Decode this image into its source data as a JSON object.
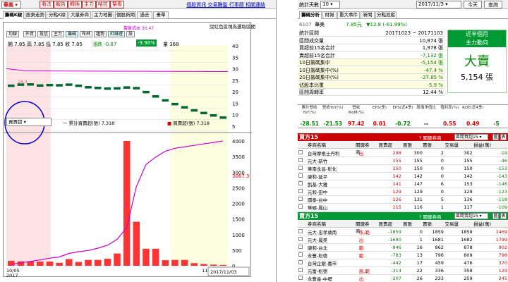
{
  "left": {
    "stock_select": "華美",
    "buttons": [
      "看法",
      "報告",
      "轉換",
      "主力",
      "哈拉",
      "幫看"
    ],
    "links": "個股資訊  交易騰盤  行事曆  相關連結",
    "tabs": [
      "籌碼K線",
      "股東走勢",
      "分點K線",
      "大量券商",
      "主力地圖",
      "個股新聞",
      "過去",
      "畫單"
    ],
    "note": "說紅色區塊為選取區間",
    "mini_buttons": [
      "均線",
      "外資",
      "投信",
      "主力",
      "籌碼",
      "布林",
      "趨勢",
      "紅綠燈",
      "設"
    ],
    "ohlc": "開 7.85  高 7.85  低 7.85  收 7.85",
    "change": "漲跌 -0.87",
    "change_pct": "-9.98%",
    "volume": "量 368",
    "cost_label": "籌量成本 30.47",
    "sub_select": "買賣超",
    "legend1": "一 累計買賣超(張) 7,318",
    "legend2": "買賣超(張) 7,318",
    "price_marker": "3067.3",
    "x_start": "10/05",
    "x_year": "2017",
    "x_mid": "11/01",
    "x_end": "2017/11/03",
    "y_top": [
      "40",
      "35",
      "30",
      "25",
      "20",
      "15",
      "10",
      "5"
    ],
    "y_bot": [
      "4000",
      "3500",
      "3000",
      "2500",
      "2000",
      "1500",
      "1000",
      "500",
      "0"
    ]
  },
  "right": {
    "days_label": "統計天數",
    "days_value": "10",
    "date": "2017/11/3",
    "btn_today": "今天",
    "btn_query": "查詢",
    "tabs": [
      "籌碼分析",
      "財報",
      "重大事件",
      "新聞",
      "分點追蹤"
    ],
    "stock_code": "6107",
    "stock_name": "華美",
    "stock_price": "7.85元",
    "stock_change": "▼12.8 (-61.99%)",
    "rows": [
      {
        "k": "統計區間",
        "v": "20171023 ~ 20171103"
      },
      {
        "k": "區間成交量",
        "v": "10,874 張"
      },
      {
        "k": "買超前15名合計",
        "v": "1,978 張"
      },
      {
        "k": "賣超前15名合計",
        "v": "-7,132 張"
      },
      {
        "k": "10日籌碼集中",
        "v": "-5,154 張"
      },
      {
        "k": "10日籌碼集中(%)",
        "v": "-47.4 %"
      },
      {
        "k": "20日籌碼集中(%)",
        "v": "-27.85 %"
      },
      {
        "k": "佔股本比重",
        "v": "-5.9 %"
      },
      {
        "k": "區間周轉率",
        "v": "12.44 %"
      }
    ],
    "box_title": "近半個月",
    "box_sub": "主力動向",
    "box_big": "大賣",
    "box_val": "5,154 張",
    "metrics_head": [
      "累計營收YoY(%)",
      "營收YoY(%)",
      "營收MoM(%)",
      "EPS(季)",
      "EPS(近4季)",
      "股價淨值比",
      "殖利率(%)",
      "ROE(近4季)"
    ],
    "metrics_val": [
      "-28.51",
      "-21.53",
      "97.42",
      "0.01",
      "-0.72",
      "--",
      "0.55",
      "0.49",
      "-5"
    ],
    "buy_title": "買方15",
    "sell_title": "賣方15",
    "filter_label": "?  關鍵券商",
    "filter_value": "區間買超15",
    "filter_value2": "區間賣超15",
    "col_heads": [
      "券商名稱",
      "關鍵券商",
      "買賣超",
      "買張",
      "賣張",
      "交易量",
      "損益(萬)"
    ],
    "buy_rows": [
      [
        "台灣摩根士丹利",
        "出",
        "298",
        "300",
        "2",
        "302",
        "-19"
      ],
      [
        "元大-新竹",
        "",
        "155",
        "155",
        "0",
        "155",
        "-46"
      ],
      [
        "華南永昌-彰化",
        "",
        "150",
        "150",
        "0",
        "150",
        "-153"
      ],
      [
        "康和-延平",
        "",
        "142",
        "142",
        "0",
        "142",
        "-143"
      ],
      [
        "凱基-大雅",
        "",
        "141",
        "147",
        "6",
        "153",
        "-146"
      ],
      [
        "元和-田中",
        "",
        "129",
        "129",
        "0",
        "129",
        "-123"
      ],
      [
        "國泰-台中",
        "",
        "126",
        "131",
        "5",
        "136",
        "-118"
      ],
      [
        "華碩-鳳山",
        "",
        "115",
        "116",
        "1",
        "117",
        "-109"
      ],
      [
        "國泰-板橋",
        "風",
        "111",
        "111",
        "0",
        "111",
        "-105"
      ]
    ],
    "sell_rows": [
      [
        "元大-忠孝敦南",
        "作,範",
        "-1859",
        "0",
        "1859",
        "1859",
        "1469"
      ],
      [
        "元大-鳳美",
        "出",
        "-1680",
        "1",
        "1681",
        "1682",
        "1799"
      ],
      [
        "康和-台北",
        "範",
        "-846",
        "16",
        "862",
        "878",
        "902"
      ],
      [
        "永豐-松德",
        "範",
        "-783",
        "13",
        "796",
        "809",
        "798"
      ],
      [
        "台灣企銀-嘉市",
        "",
        "-442",
        "17",
        "459",
        "476",
        "370"
      ],
      [
        "元富-松德",
        "風,範",
        "-314",
        "22",
        "336",
        "358",
        "129"
      ],
      [
        "永豐金-中壢",
        "出",
        "-207",
        "26",
        "233",
        "259",
        "245"
      ],
      [
        "元富-城東",
        "",
        "-182",
        "18",
        "200",
        "218",
        "185"
      ]
    ]
  },
  "chart_data": {
    "type": "bar",
    "title": "",
    "categories": [
      "10/05",
      "",
      "",
      "",
      "",
      "",
      "",
      "",
      "",
      "",
      "",
      "",
      "",
      "",
      "",
      "",
      "",
      "",
      "",
      "",
      "",
      "11/01",
      "11/03"
    ],
    "price_kline": [
      23.3,
      23.8,
      23.9,
      23.4,
      23.6,
      23.5,
      23.8,
      23.3,
      22.6,
      22.3,
      22.0,
      22.1,
      22.5,
      22.2,
      20.4,
      18.4,
      16.6,
      14.9,
      13.4,
      12.0,
      10.8,
      9.7,
      8.7
    ],
    "series": [
      {
        "name": "買賣超(張)",
        "values": [
          170,
          150,
          150,
          140,
          140,
          100,
          230,
          130,
          200,
          200,
          240,
          420,
          4250,
          1500,
          580,
          580,
          190,
          200,
          200,
          90,
          60,
          40,
          30
        ]
      },
      {
        "name": "一 累計買賣超(張)",
        "values": [
          50,
          100,
          150,
          200,
          260,
          300,
          420,
          480,
          520,
          600,
          700,
          900,
          1300,
          2700,
          3450,
          3700,
          3900,
          4000,
          4050,
          4100,
          4150,
          4200,
          4250
        ]
      }
    ],
    "ylim_top": [
      0,
      42
    ],
    "ylim_bottom": [
      0,
      4200
    ]
  }
}
